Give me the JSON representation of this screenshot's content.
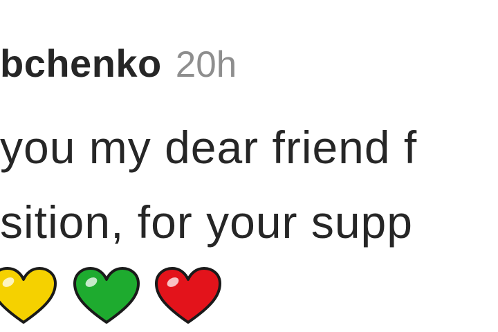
{
  "post": {
    "author": "bchenko",
    "timestamp": "20h",
    "text_lines": [
      "you my dear friend f",
      "sition, for your supp"
    ],
    "emojis": [
      {
        "name": "yellow-heart",
        "color": "#f5d100"
      },
      {
        "name": "green-heart",
        "color": "#1eab2f"
      },
      {
        "name": "red-heart",
        "color": "#e3131b"
      }
    ]
  }
}
